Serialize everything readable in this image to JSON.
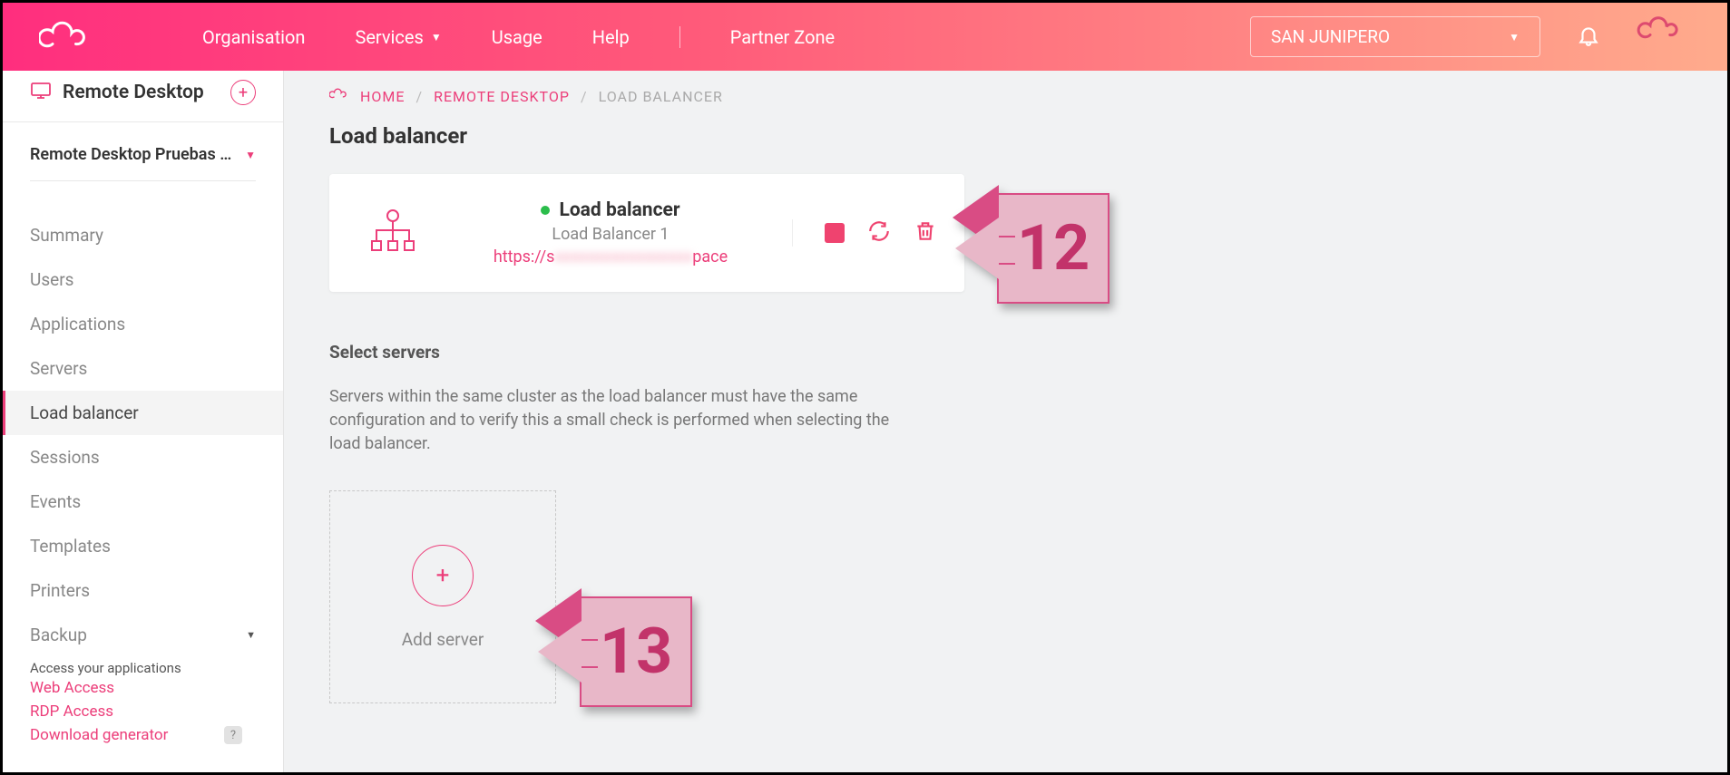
{
  "header": {
    "nav": {
      "organisation": "Organisation",
      "services": "Services",
      "usage": "Usage",
      "help": "Help",
      "partner": "Partner Zone"
    },
    "workspace": "SAN JUNIPERO"
  },
  "sidebar": {
    "title": "Remote Desktop",
    "project": "Remote Desktop Pruebas …",
    "items": {
      "summary": "Summary",
      "users": "Users",
      "applications": "Applications",
      "servers": "Servers",
      "load_balancer": "Load balancer",
      "sessions": "Sessions",
      "events": "Events",
      "templates": "Templates",
      "printers": "Printers",
      "backup": "Backup"
    },
    "access_label": "Access your applications",
    "access_links": {
      "web": "Web Access",
      "rdp": "RDP Access",
      "download": "Download generator"
    },
    "badge_q": "?"
  },
  "breadcrumb": {
    "home": "HOME",
    "section": "REMOTE DESKTOP",
    "current": "LOAD BALANCER"
  },
  "page": {
    "title": "Load balancer"
  },
  "lb": {
    "title": "Load balancer",
    "name": "Load Balancer 1",
    "url_prefix": "https://s",
    "url_suffix": "pace"
  },
  "select_servers": {
    "title": "Select servers",
    "desc": "Servers within the same cluster as the load balancer must have the same configuration and to verify this a small check is performed when selecting the load balancer."
  },
  "add_server": {
    "label": "Add server"
  },
  "callouts": {
    "c12": "12",
    "c13": "13"
  }
}
